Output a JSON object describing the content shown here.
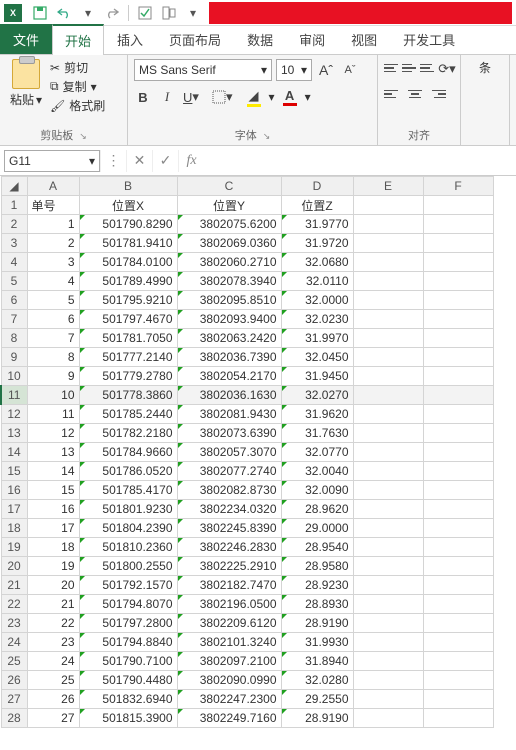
{
  "qat": {
    "app_abbr": "X"
  },
  "tabs": {
    "file": "文件",
    "items": [
      "开始",
      "插入",
      "页面布局",
      "数据",
      "审阅",
      "视图",
      "开发工具"
    ],
    "active_index": 0
  },
  "ribbon": {
    "clipboard": {
      "label": "剪贴板",
      "paste": "粘贴",
      "cut": "剪切",
      "copy": "复制",
      "format_painter": "格式刷"
    },
    "font": {
      "label": "字体",
      "name": "MS Sans Serif",
      "size": "10",
      "bold": "B",
      "italic": "I",
      "underline": "U",
      "increase": "A",
      "decrease": "A"
    },
    "alignment": {
      "label": "对齐"
    },
    "style_partial": "条"
  },
  "namebox": {
    "value": "G11"
  },
  "formula_bar": {
    "fx": "fx",
    "value": ""
  },
  "columns": [
    "A",
    "B",
    "C",
    "D",
    "E",
    "F"
  ],
  "headers": {
    "A": "单号",
    "B": "位置X",
    "C": "位置Y",
    "D": "位置Z"
  },
  "selected_row": 11,
  "rows": [
    {
      "n": 1
    },
    {
      "n": 2,
      "A": "1",
      "B": "501790.8290",
      "C": "3802075.6200",
      "D": "31.9770"
    },
    {
      "n": 3,
      "A": "2",
      "B": "501781.9410",
      "C": "3802069.0360",
      "D": "31.9720"
    },
    {
      "n": 4,
      "A": "3",
      "B": "501784.0100",
      "C": "3802060.2710",
      "D": "32.0680"
    },
    {
      "n": 5,
      "A": "4",
      "B": "501789.4990",
      "C": "3802078.3940",
      "D": "32.0110"
    },
    {
      "n": 6,
      "A": "5",
      "B": "501795.9210",
      "C": "3802095.8510",
      "D": "32.0000"
    },
    {
      "n": 7,
      "A": "6",
      "B": "501797.4670",
      "C": "3802093.9400",
      "D": "32.0230"
    },
    {
      "n": 8,
      "A": "7",
      "B": "501781.7050",
      "C": "3802063.2420",
      "D": "31.9970"
    },
    {
      "n": 9,
      "A": "8",
      "B": "501777.2140",
      "C": "3802036.7390",
      "D": "32.0450"
    },
    {
      "n": 10,
      "A": "9",
      "B": "501779.2780",
      "C": "3802054.2170",
      "D": "31.9450"
    },
    {
      "n": 11,
      "A": "10",
      "B": "501778.3860",
      "C": "3802036.1630",
      "D": "32.0270"
    },
    {
      "n": 12,
      "A": "11",
      "B": "501785.2440",
      "C": "3802081.9430",
      "D": "31.9620"
    },
    {
      "n": 13,
      "A": "12",
      "B": "501782.2180",
      "C": "3802073.6390",
      "D": "31.7630"
    },
    {
      "n": 14,
      "A": "13",
      "B": "501784.9660",
      "C": "3802057.3070",
      "D": "32.0770"
    },
    {
      "n": 15,
      "A": "14",
      "B": "501786.0520",
      "C": "3802077.2740",
      "D": "32.0040"
    },
    {
      "n": 16,
      "A": "15",
      "B": "501785.4170",
      "C": "3802082.8730",
      "D": "32.0090"
    },
    {
      "n": 17,
      "A": "16",
      "B": "501801.9230",
      "C": "3802234.0320",
      "D": "28.9620"
    },
    {
      "n": 18,
      "A": "17",
      "B": "501804.2390",
      "C": "3802245.8390",
      "D": "29.0000"
    },
    {
      "n": 19,
      "A": "18",
      "B": "501810.2360",
      "C": "3802246.2830",
      "D": "28.9540"
    },
    {
      "n": 20,
      "A": "19",
      "B": "501800.2550",
      "C": "3802225.2910",
      "D": "28.9580"
    },
    {
      "n": 21,
      "A": "20",
      "B": "501792.1570",
      "C": "3802182.7470",
      "D": "28.9230"
    },
    {
      "n": 22,
      "A": "21",
      "B": "501794.8070",
      "C": "3802196.0500",
      "D": "28.8930"
    },
    {
      "n": 23,
      "A": "22",
      "B": "501797.2800",
      "C": "3802209.6120",
      "D": "28.9190"
    },
    {
      "n": 24,
      "A": "23",
      "B": "501794.8840",
      "C": "3802101.3240",
      "D": "31.9930"
    },
    {
      "n": 25,
      "A": "24",
      "B": "501790.7100",
      "C": "3802097.2100",
      "D": "31.8940"
    },
    {
      "n": 26,
      "A": "25",
      "B": "501790.4480",
      "C": "3802090.0990",
      "D": "32.0280"
    },
    {
      "n": 27,
      "A": "26",
      "B": "501832.6940",
      "C": "3802247.2300",
      "D": "29.2550"
    },
    {
      "n": 28,
      "A": "27",
      "B": "501815.3900",
      "C": "3802249.7160",
      "D": "28.9190"
    }
  ]
}
